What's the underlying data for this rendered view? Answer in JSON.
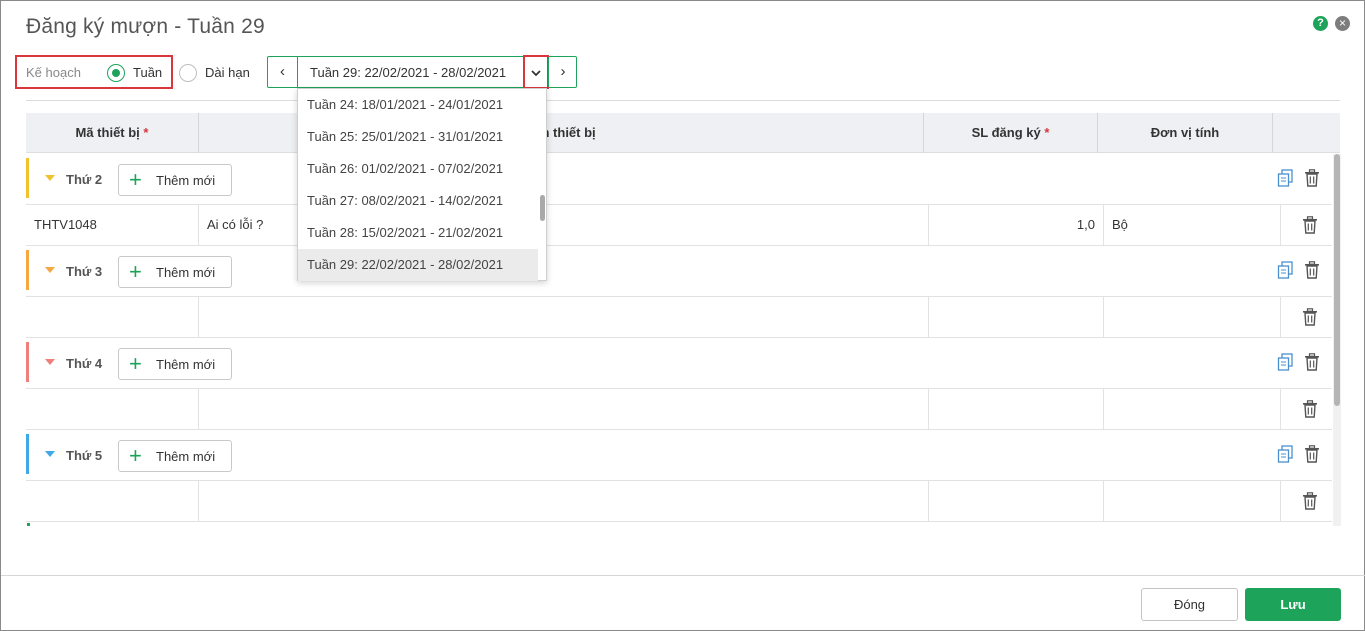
{
  "dialog": {
    "title": "Đăng ký mượn - Tuần 29",
    "help_glyph": "?",
    "close_glyph": "×"
  },
  "toolbar": {
    "plan_label": "Kế hoạch",
    "radio_week_label": "Tuần",
    "radio_long_label": "Dài hạn",
    "selected_mode": "Tuần",
    "week_value": "Tuần 29: 22/02/2021 - 28/02/2021",
    "prev_glyph": "‹",
    "next_glyph": "›",
    "dropdown_glyph": "⌄"
  },
  "table": {
    "columns": [
      {
        "label": "Mã thiết bị",
        "required": true
      },
      {
        "label": "Tên thiết bị",
        "required": false
      },
      {
        "label": "SL đăng ký",
        "required": true
      },
      {
        "label": "Đơn vị tính",
        "required": false
      }
    ],
    "required_mark": "*",
    "add_label": "Thêm mới",
    "groups": [
      {
        "day": "Thứ 2",
        "color": "#f2c12e",
        "rows": [
          {
            "code": "THTV1048",
            "name": "Ai có lỗi ?",
            "qty": "1,0",
            "unit": "Bộ"
          }
        ]
      },
      {
        "day": "Thứ 3",
        "color": "#f5a742",
        "rows": [
          {
            "code": "",
            "name": "",
            "qty": "",
            "unit": ""
          }
        ]
      },
      {
        "day": "Thứ 4",
        "color": "#ef7f7a",
        "rows": [
          {
            "code": "",
            "name": "",
            "qty": "",
            "unit": ""
          }
        ]
      },
      {
        "day": "Thứ 5",
        "color": "#3fa9e8",
        "rows": [
          {
            "code": "",
            "name": "",
            "qty": "",
            "unit": ""
          }
        ]
      }
    ]
  },
  "week_dropdown": {
    "options": [
      "Tuần 24: 18/01/2021 - 24/01/2021",
      "Tuần 25: 25/01/2021 - 31/01/2021",
      "Tuần 26: 01/02/2021 - 07/02/2021",
      "Tuần 27: 08/02/2021 - 14/02/2021",
      "Tuần 28: 15/02/2021 - 21/02/2021",
      "Tuần 29: 22/02/2021 - 28/02/2021"
    ],
    "selected": "Tuần 29: 22/02/2021 - 28/02/2021"
  },
  "footer": {
    "close_label": "Đóng",
    "save_label": "Lưu"
  },
  "colors": {
    "accent": "#1ea35a",
    "highlight_red": "#d9363e",
    "icon_blue": "#4a8fd0"
  },
  "icons": [
    "help-icon",
    "close-icon",
    "chevron-left-icon",
    "chevron-right-icon",
    "chevron-down-icon",
    "plus-icon",
    "copy-icon",
    "trash-icon",
    "collapse-triangle-icon"
  ]
}
